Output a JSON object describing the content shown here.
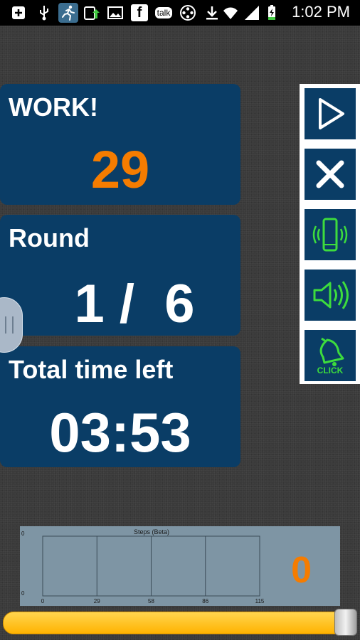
{
  "status_bar": {
    "time": "1:02 PM",
    "talk_label": "talk",
    "facebook_letter": "f"
  },
  "work_panel": {
    "label": "WORK!",
    "value": "29",
    "value_color": "#f57c00"
  },
  "round_panel": {
    "label": "Round",
    "value": "1 /  6"
  },
  "time_panel": {
    "label": "Total time left",
    "value": "03:53"
  },
  "toolbar": {
    "buttons": [
      {
        "icon": "play-icon"
      },
      {
        "icon": "close-icon"
      },
      {
        "icon": "vibrate-phone-icon"
      },
      {
        "icon": "speaker-icon"
      },
      {
        "icon": "bell-icon",
        "label": "CLICK"
      }
    ],
    "icon_color_active": "#3ddc3d"
  },
  "chart_data": {
    "type": "line",
    "title": "Steps (Beta)",
    "x_ticks": [
      "0",
      "29",
      "58",
      "86",
      "115"
    ],
    "y_ticks": [
      "0",
      "0"
    ],
    "series": [],
    "grid": true
  },
  "steps": {
    "count": "0"
  },
  "progress": {
    "fraction": 0.97,
    "color": "#ffc107"
  },
  "colors": {
    "panel": "#0a3d66",
    "accent": "#f57c00",
    "background": "#3a3a3a"
  }
}
